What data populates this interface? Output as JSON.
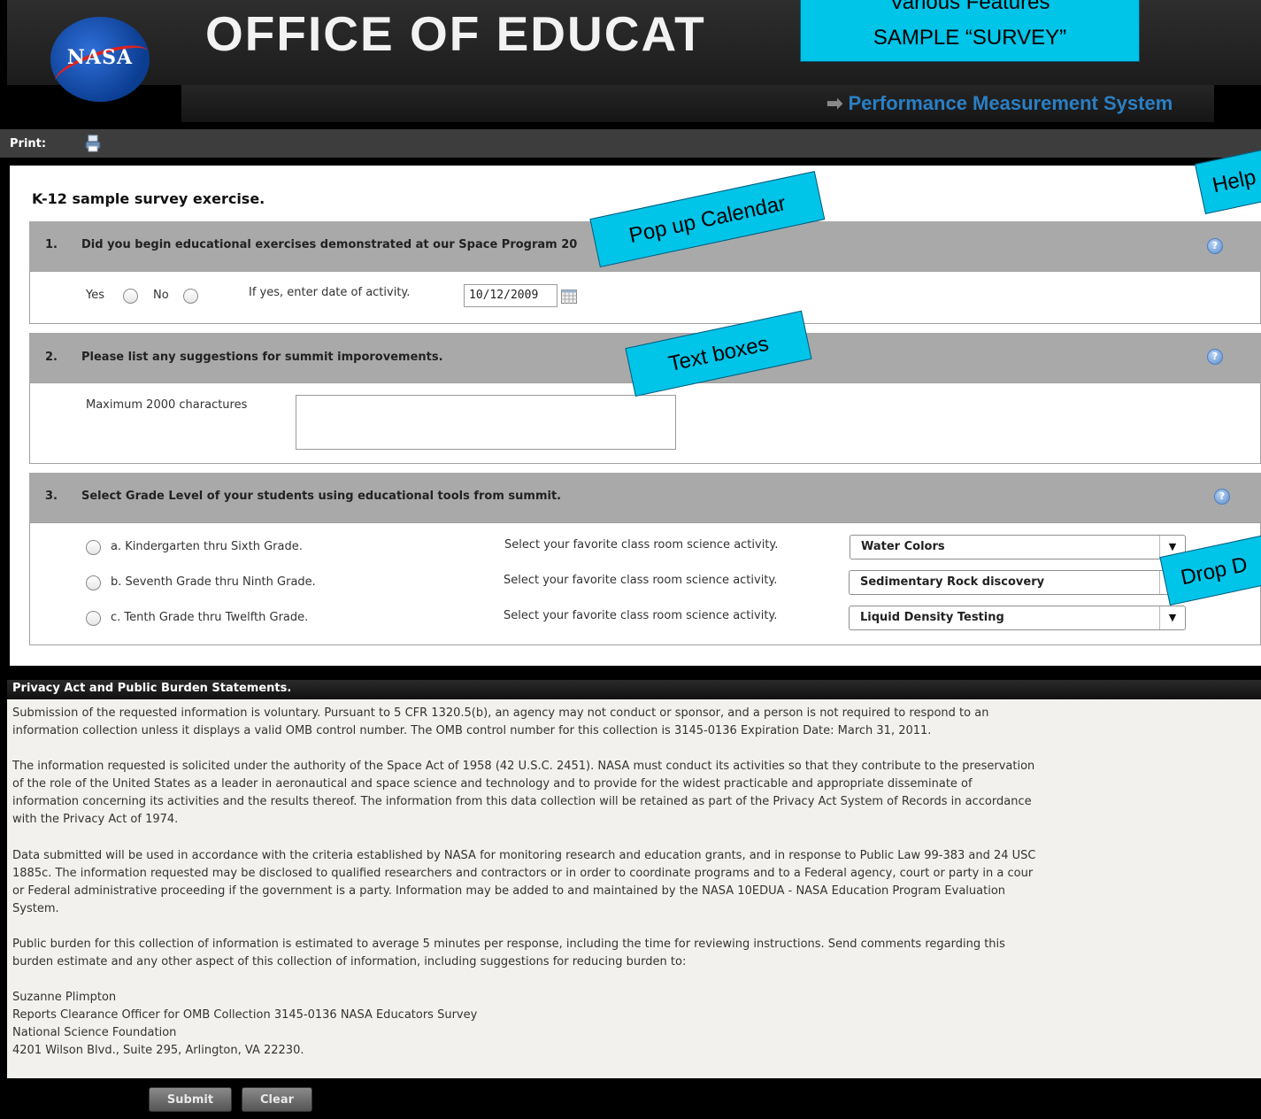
{
  "header": {
    "logo_text": "NASA",
    "title": "OFFICE OF EDUCAT",
    "subtitle": "Performance Measurement System"
  },
  "toolbar": {
    "print_label": "Print:"
  },
  "survey": {
    "title": "K-12 sample survey exercise.",
    "q1": {
      "num": "1.",
      "text": "Did you begin educational exercises demonstrated at our Space Program 20",
      "yes_label": "Yes",
      "no_label": "No",
      "date_label": "If yes, enter date of activity.",
      "date_value": "10/12/2009"
    },
    "q2": {
      "num": "2.",
      "text": "Please list any suggestions for summit imporovements.",
      "max_label": "Maximum 2000 charactures"
    },
    "q3": {
      "num": "3.",
      "text": "Select Grade Level of your students using educational tools from summit.",
      "options": [
        {
          "label": "a. Kindergarten thru Sixth Grade.",
          "prompt": "Select your favorite class room science activity.",
          "selected": "Water Colors"
        },
        {
          "label": "b. Seventh Grade thru Ninth Grade.",
          "prompt": "Select your favorite class room science activity.",
          "selected": "Sedimentary Rock discovery"
        },
        {
          "label": "c. Tenth Grade thru Twelfth Grade.",
          "prompt": "Select your favorite class room science activity.",
          "selected": "Liquid Density Testing"
        }
      ]
    }
  },
  "callouts": {
    "features_line1": "Various Features",
    "features_line2": "SAMPLE “SURVEY”",
    "help": "Help",
    "calendar": "Pop up Calendar",
    "textboxes": "Text boxes",
    "dropdown": "Drop D"
  },
  "privacy": {
    "heading": "Privacy Act and Public Burden Statements.",
    "p1_l1": "Submission of the requested information is voluntary. Pursuant to 5 CFR 1320.5(b), an agency may not conduct or sponsor, and a person is not required to respond to an",
    "p1_l2": "information collection unless it displays a valid OMB control number. The OMB control number for this collection is 3145-0136 Expiration Date: March 31, 2011.",
    "p2_l1": "The information requested is solicited under the authority of the Space Act of 1958 (42 U.S.C. 2451). NASA must conduct its activities so that they contribute to the preservation",
    "p2_l2": "of the role of the United States as a leader in aeronautical and space science and technology and to provide for the widest practicable and appropriate disseminate of",
    "p2_l3": "information concerning its activities and the results thereof. The information from this data collection will be retained as part of the Privacy Act System of Records in accordance",
    "p2_l4": "with the Privacy Act of 1974.",
    "p3_l1": "Data submitted will be used in accordance with the criteria established by NASA for monitoring research and education grants, and in response to Public Law 99-383 and 24 USC",
    "p3_l2": "1885c. The information requested may be disclosed to qualified researchers and contractors or in order to coordinate programs and to a Federal agency, court or party in a cour",
    "p3_l3": "or Federal administrative proceeding if the government is a party. Information may be added to and maintained by the NASA 10EDUA - NASA Education Program Evaluation",
    "p3_l4": "System.",
    "p4_l1": "Public burden for this collection of information is estimated to average 5 minutes per response, including the time for reviewing instructions. Send comments regarding this",
    "p4_l2": "burden estimate and any other aspect of this collection of information, including suggestions for reducing burden to:",
    "addr_l1": "Suzanne Plimpton",
    "addr_l2": "Reports Clearance Officer for OMB Collection 3145-0136 NASA Educators Survey",
    "addr_l3": "National Science Foundation",
    "addr_l4": "4201 Wilson Blvd., Suite 295, Arlington, VA 22230."
  },
  "buttons": {
    "submit": "Submit",
    "clear": "Clear"
  },
  "colors": {
    "callout": "#00c4e8",
    "link_blue": "#2b7fc4",
    "question_header": "#a9a9a9"
  }
}
